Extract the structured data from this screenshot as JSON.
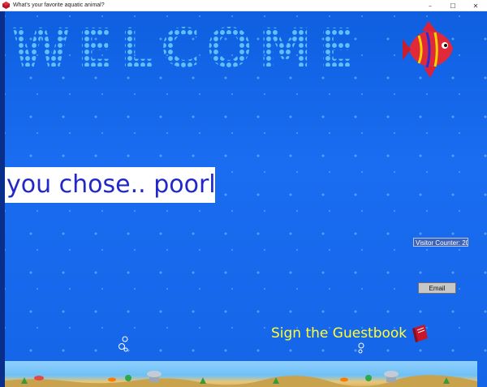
{
  "window": {
    "title": "What's your favorite aquatic animal?",
    "controls": {
      "minimize": "–",
      "maximize": "☐",
      "close": "✕"
    }
  },
  "page": {
    "welcome_letters": [
      "W",
      "E",
      "L",
      "C",
      "O",
      "M",
      "E"
    ],
    "result_text": "you chose.. poorly",
    "visitor_counter": "Visitor Counter: 20",
    "email_button": "Email",
    "guestbook_link": "Sign the Guestbook"
  },
  "colors": {
    "background": "#1565e8",
    "result_text": "#2228c8",
    "guestbook_text": "#ffff33",
    "counter_bg": "#3c63b8"
  },
  "icons": [
    "app-icon",
    "fish-image",
    "book-icon",
    "diver-icon",
    "bubble-icon"
  ]
}
